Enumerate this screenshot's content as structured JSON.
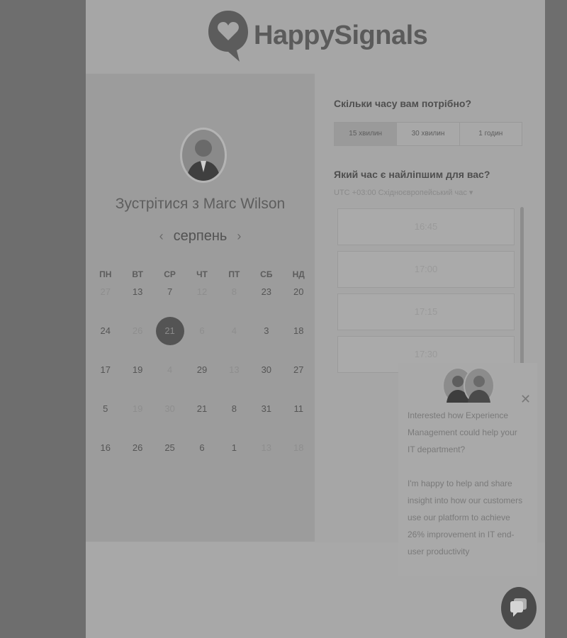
{
  "logo": {
    "text": "HappySignals"
  },
  "left": {
    "meet_title": "Зустрітися з Marc Wilson",
    "month": "серпень",
    "weekdays": [
      "ПН",
      "ВТ",
      "СР",
      "ЧТ",
      "ПТ",
      "СБ",
      "НД"
    ],
    "weeks": [
      [
        "27",
        "13",
        "7",
        "12",
        "8",
        "23",
        "20"
      ],
      [
        "24",
        "26",
        "21",
        "6",
        "4",
        "3",
        "18"
      ],
      [
        "17",
        "19",
        "4",
        "29",
        "13",
        "30",
        "27"
      ],
      [
        "5",
        "19",
        "30",
        "21",
        "8",
        "31",
        "11"
      ],
      [
        "16",
        "26",
        "25",
        "6",
        "1",
        "13",
        "18"
      ]
    ],
    "selected_day": "21"
  },
  "right": {
    "duration_question": "Скільки часу вам потрібно?",
    "durations": [
      "15 хвилин",
      "30 хвилин",
      "1 годин"
    ],
    "time_question": "Який час є найліпшим для вас?",
    "timezone": "UTC +03:00 Східноєвропейський час",
    "slots": [
      "16:45",
      "17:00",
      "17:15",
      "17:30"
    ]
  },
  "popup": {
    "line1": "Interested how Experience Management could help your IT department?",
    "line2": "I'm happy to help and share insight into how our customers use our platform to achieve 26% improvement in IT end-user productivity"
  }
}
